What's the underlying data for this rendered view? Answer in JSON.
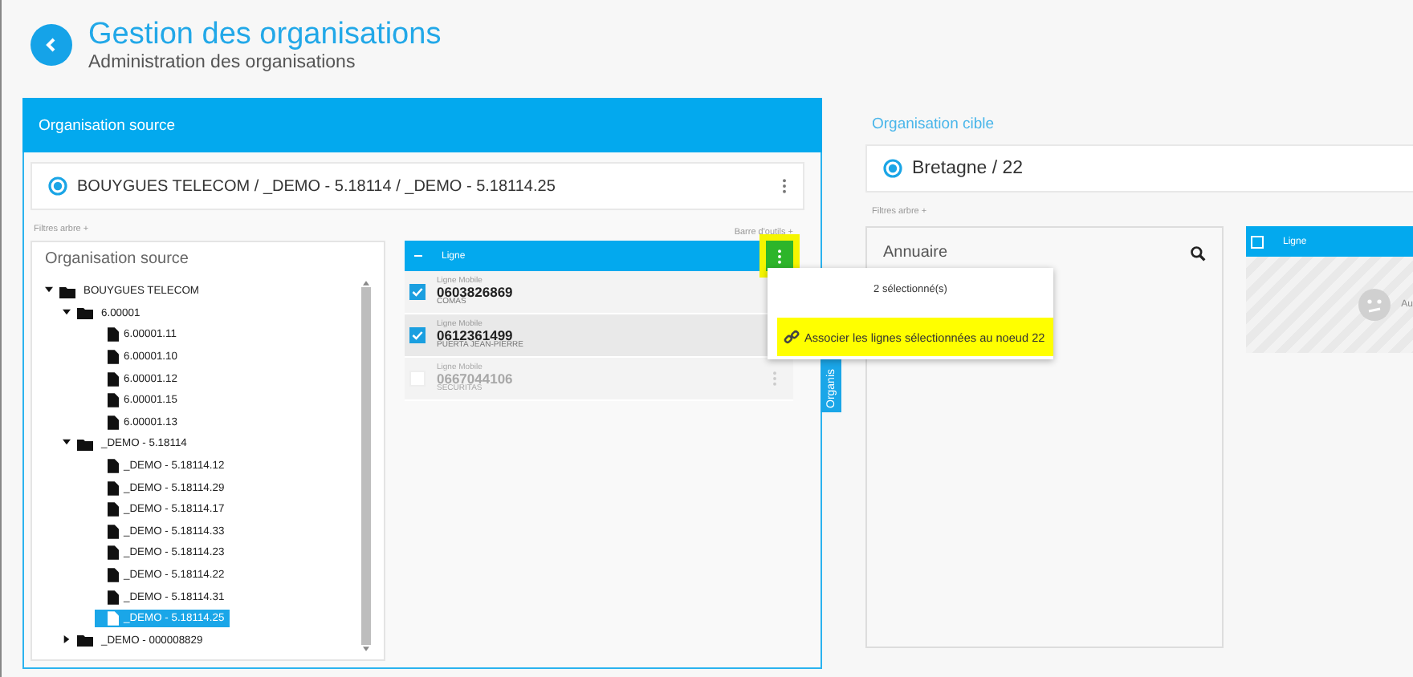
{
  "header": {
    "title": "Gestion des organisations",
    "subtitle": "Administration des organisations"
  },
  "source": {
    "title": "Organisation source",
    "path": "BOUYGUES TELECOM / _DEMO - 5.18114 / _DEMO - 5.18114.25",
    "filters": "Filtres arbre +",
    "tree_title": "Organisation source",
    "tree": [
      {
        "label": "BOUYGUES TELECOM",
        "kind": "folder",
        "expanded": true,
        "selected": false,
        "children": [
          {
            "label": "6.00001",
            "kind": "folder",
            "expanded": true,
            "selected": false,
            "children": [
              {
                "label": "6.00001.11",
                "kind": "file",
                "selected": false
              },
              {
                "label": "6.00001.10",
                "kind": "file",
                "selected": false
              },
              {
                "label": "6.00001.12",
                "kind": "file",
                "selected": false
              },
              {
                "label": "6.00001.15",
                "kind": "file",
                "selected": false
              },
              {
                "label": "6.00001.13",
                "kind": "file",
                "selected": false
              }
            ]
          },
          {
            "label": "_DEMO - 5.18114",
            "kind": "folder",
            "expanded": true,
            "selected": false,
            "children": [
              {
                "label": "_DEMO - 5.18114.12",
                "kind": "file",
                "selected": false
              },
              {
                "label": "_DEMO - 5.18114.29",
                "kind": "file",
                "selected": false
              },
              {
                "label": "_DEMO - 5.18114.17",
                "kind": "file",
                "selected": false
              },
              {
                "label": "_DEMO - 5.18114.33",
                "kind": "file",
                "selected": false
              },
              {
                "label": "_DEMO - 5.18114.23",
                "kind": "file",
                "selected": false
              },
              {
                "label": "_DEMO - 5.18114.22",
                "kind": "file",
                "selected": false
              },
              {
                "label": "_DEMO - 5.18114.31",
                "kind": "file",
                "selected": false
              },
              {
                "label": "_DEMO - 5.18114.25",
                "kind": "file",
                "selected": true
              }
            ]
          },
          {
            "label": "_DEMO - 000008829",
            "kind": "folder",
            "expanded": false,
            "selected": false
          }
        ]
      }
    ],
    "toolbar": "Barre d'outils +",
    "table_header": "Ligne",
    "lines": [
      {
        "type": "Ligne Mobile",
        "number": "0603826869",
        "owner": "COMAS",
        "checked": true,
        "disabled": false
      },
      {
        "type": "Ligne Mobile",
        "number": "0612361499",
        "owner": "PUERTA JEAN-PIERRE",
        "checked": true,
        "disabled": false
      },
      {
        "type": "Ligne Mobile",
        "number": "0667044106",
        "owner": "SECURITAS",
        "checked": false,
        "disabled": true
      }
    ],
    "side_tab": "Organis"
  },
  "menu": {
    "count": "2 sélectionné(s)",
    "items": [
      {
        "label": "Associer les lignes sélectionnées au noeud 22",
        "highlighted": true
      }
    ]
  },
  "target": {
    "title": "Organisation cible",
    "path": "Bretagne / 22",
    "filters": "Filtres arbre +",
    "directory_title": "Annuaire",
    "table_header": "Ligne",
    "header_checked": false,
    "empty_text": "Au"
  }
}
